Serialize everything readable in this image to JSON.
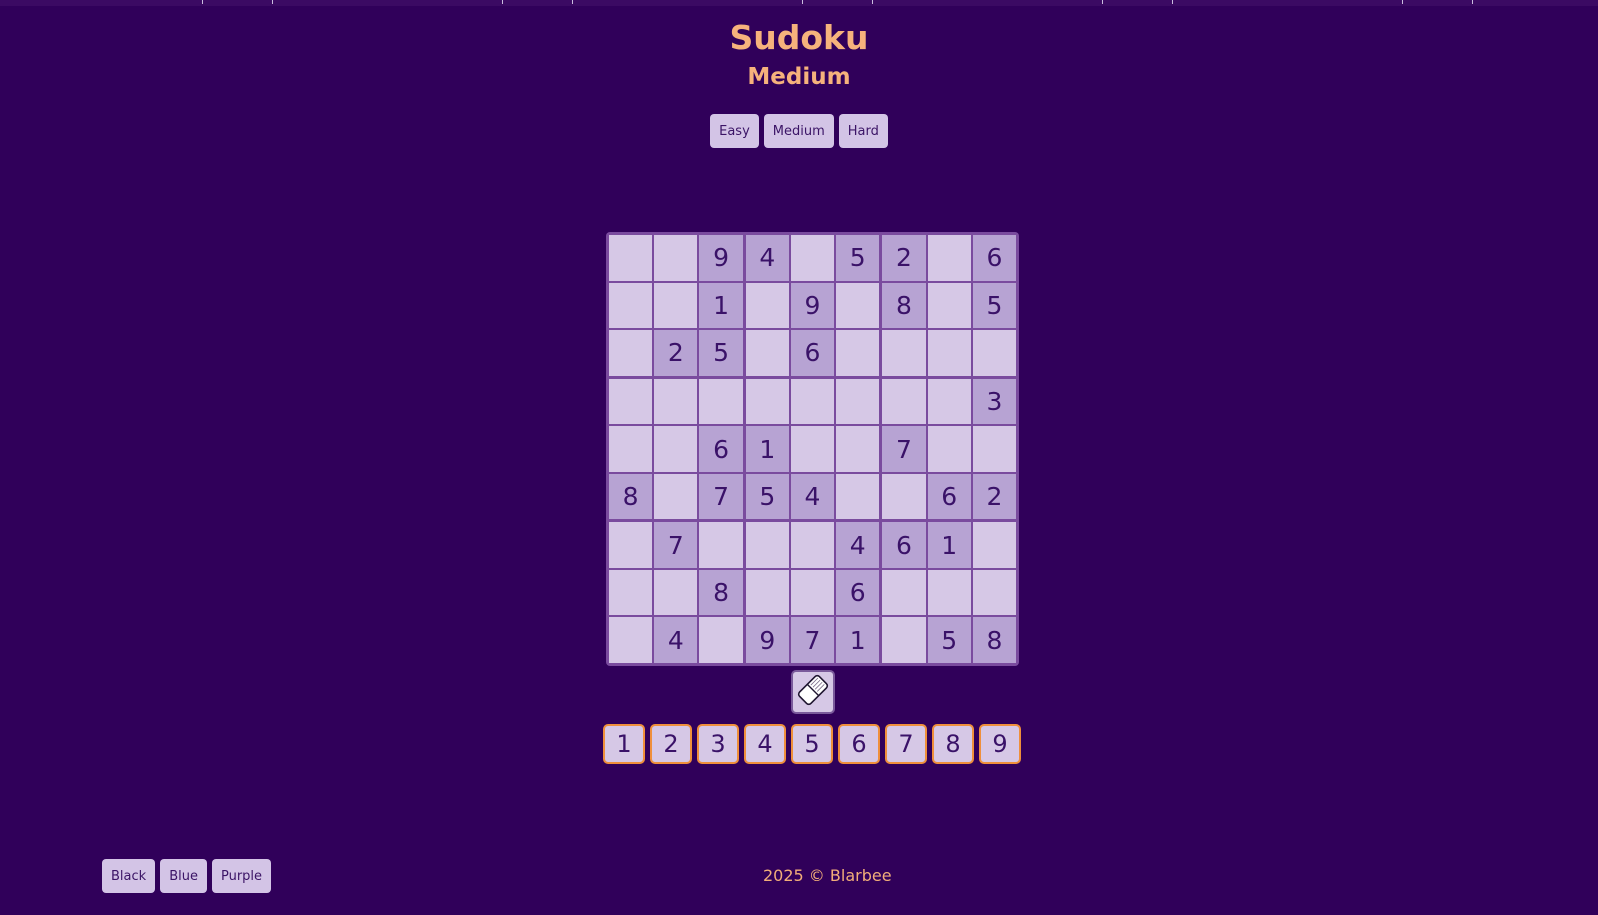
{
  "title": "Sudoku",
  "difficulty": "Medium",
  "difficulty_buttons": [
    "Easy",
    "Medium",
    "Hard"
  ],
  "board": [
    [
      0,
      0,
      9,
      4,
      0,
      5,
      2,
      0,
      6
    ],
    [
      0,
      0,
      1,
      0,
      9,
      0,
      8,
      0,
      5
    ],
    [
      0,
      2,
      5,
      0,
      6,
      0,
      0,
      0,
      0
    ],
    [
      0,
      0,
      0,
      0,
      0,
      0,
      0,
      0,
      3
    ],
    [
      0,
      0,
      6,
      1,
      0,
      0,
      7,
      0,
      0
    ],
    [
      8,
      0,
      7,
      5,
      4,
      0,
      0,
      6,
      2
    ],
    [
      0,
      7,
      0,
      0,
      0,
      4,
      6,
      1,
      0
    ],
    [
      0,
      0,
      8,
      0,
      0,
      6,
      0,
      0,
      0
    ],
    [
      0,
      4,
      0,
      9,
      7,
      1,
      0,
      5,
      8
    ]
  ],
  "eraser_icon": "eraser-icon",
  "numpad": [
    "1",
    "2",
    "3",
    "4",
    "5",
    "6",
    "7",
    "8",
    "9"
  ],
  "theme_buttons": [
    "Black",
    "Blue",
    "Purple"
  ],
  "footer": "2025 © Blarbee",
  "colors": {
    "background": "#30005a",
    "accent": "#f6b27c",
    "cell": "#d6c8e6",
    "given_cell": "#b7a3d3",
    "digit": "#3a1268",
    "numpad_border": "#ef8f3b"
  }
}
